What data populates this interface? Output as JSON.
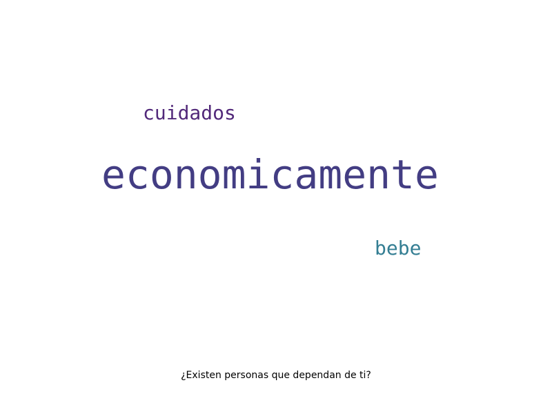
{
  "wordcloud": {
    "words": [
      {
        "text": "cuidados",
        "color": "#52297a"
      },
      {
        "text": "economicamente",
        "color": "#433d83"
      },
      {
        "text": "bebe",
        "color": "#347e93"
      }
    ]
  },
  "caption": "¿Existen personas que dependan de ti?"
}
